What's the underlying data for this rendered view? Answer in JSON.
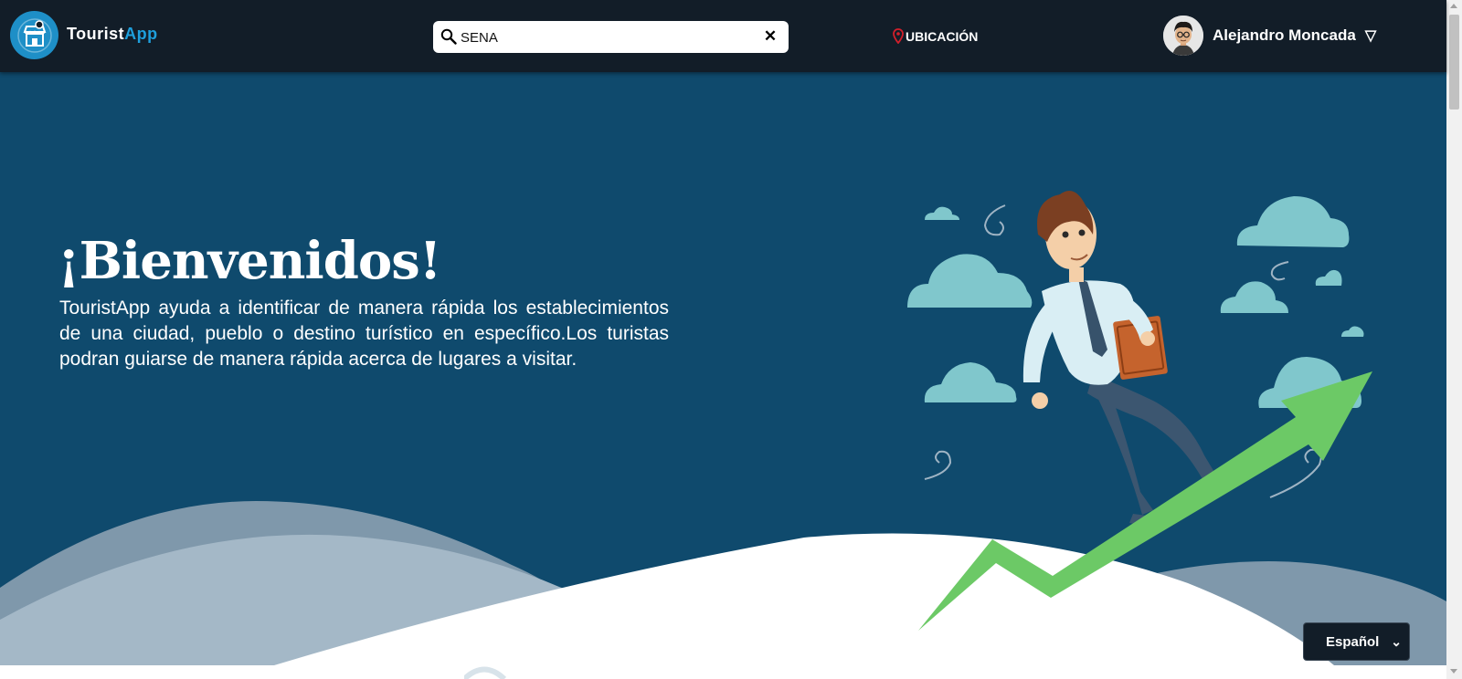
{
  "nav": {
    "brand_main": "Tourist",
    "brand_accent": "App",
    "search_value": "SENA",
    "clear_symbol": "✕",
    "location_label": "UBICACIÓN",
    "user_name": "Alejandro Moncada",
    "user_caret": "▽"
  },
  "hero": {
    "title": "¡Bienvenidos!",
    "description": "TouristApp ayuda a identificar de manera rápida los establecimientos de una ciudad, pueblo o destino turístico en específico.Los turistas podran guiarse de manera rápida acerca de lugares a visitar."
  },
  "language": {
    "selected": "Español",
    "caret": "⌄"
  },
  "icons": {
    "logo": "store-icon",
    "search": "search-icon",
    "clear": "close-icon",
    "location": "map-pin-icon",
    "caret": "triangle-down-icon",
    "avatar": "user-avatar"
  },
  "colors": {
    "navbar_bg": "#121d28",
    "hero_bg": "#0f4a6d",
    "brand_accent": "#1e9fdc",
    "location_pin": "#d21f2b",
    "arrow_green": "#6cc966",
    "cloud": "#80c7cc"
  }
}
